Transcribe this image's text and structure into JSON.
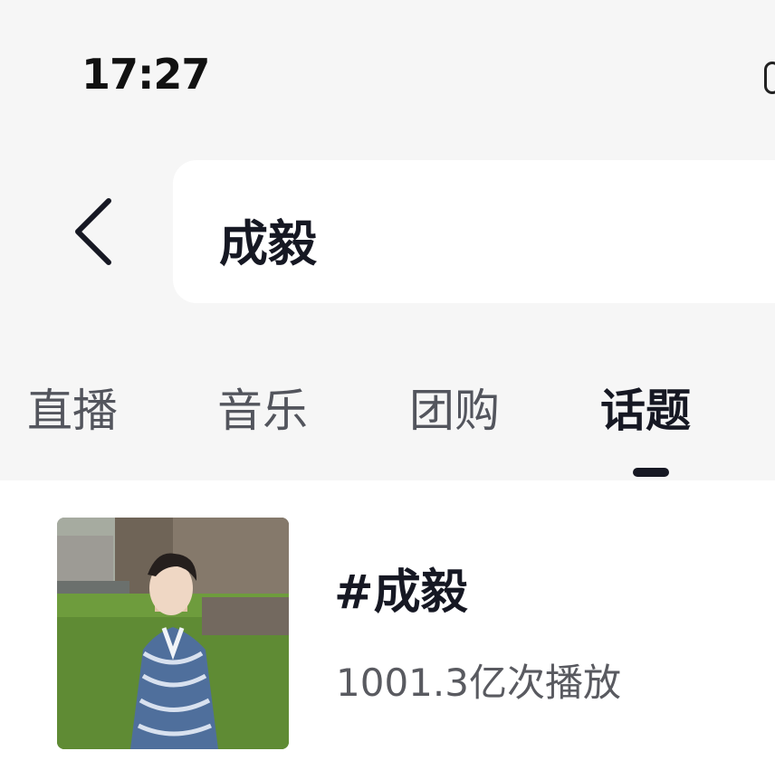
{
  "status_bar": {
    "time": "17:27"
  },
  "search": {
    "query": "成毅"
  },
  "tabs": [
    {
      "label": "直播",
      "active": false
    },
    {
      "label": "音乐",
      "active": false
    },
    {
      "label": "团购",
      "active": false
    },
    {
      "label": "话题",
      "active": true
    }
  ],
  "results": [
    {
      "title": "#成毅",
      "plays": "1001.3亿次播放"
    }
  ],
  "icons": {
    "back": "chevron-left-icon"
  },
  "colors": {
    "background": "#f6f6f6",
    "card": "#ffffff",
    "text_primary": "#161823",
    "text_secondary": "#595a60"
  }
}
